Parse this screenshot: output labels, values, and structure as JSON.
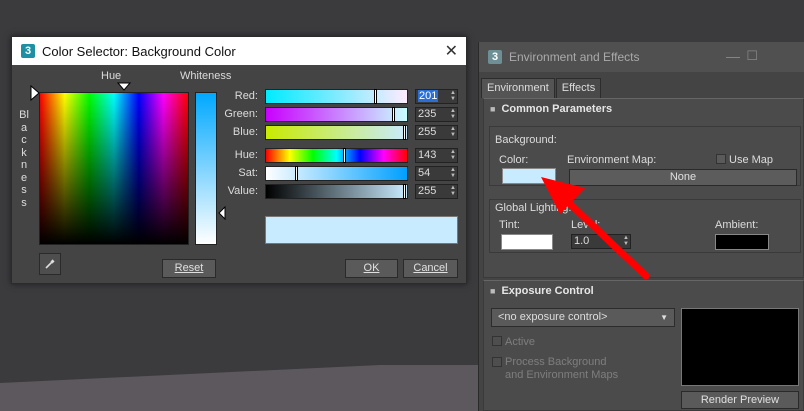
{
  "color_dialog": {
    "title": "Color Selector: Background Color",
    "hue_label": "Hue",
    "whiteness_label": "Whiteness",
    "blackness_label": "Blackness",
    "channels": [
      {
        "label": "Red:",
        "value": "201",
        "fraction": 0.79
      },
      {
        "label": "Green:",
        "value": "235",
        "fraction": 0.92
      },
      {
        "label": "Blue:",
        "value": "255",
        "fraction": 1.0
      },
      {
        "label": "Hue:",
        "value": "143",
        "fraction": 0.56
      },
      {
        "label": "Sat:",
        "value": "54",
        "fraction": 0.21
      },
      {
        "label": "Value:",
        "value": "255",
        "fraction": 1.0
      }
    ],
    "preview_color": "#c9ebff",
    "reset_label": "Reset",
    "ok_label": "OK",
    "cancel_label": "Cancel"
  },
  "env_window": {
    "title": "Environment and Effects",
    "tabs": [
      "Environment",
      "Effects"
    ],
    "common_params_title": "Common Parameters",
    "background_label": "Background:",
    "color_label": "Color:",
    "env_map_label": "Environment Map:",
    "use_map_label": "Use Map",
    "none_label": "None",
    "bg_color": "#c9ebff",
    "global_lighting_label": "Global Lighting:",
    "tint_label": "Tint:",
    "level_label": "Level:",
    "level_value": "1.0",
    "ambient_label": "Ambient:",
    "exposure_title": "Exposure Control",
    "exposure_dropdown": "<no exposure control>",
    "active_label": "Active",
    "process_bg_line1": "Process Background",
    "process_bg_line2": "and Environment Maps",
    "render_preview_label": "Render Preview"
  },
  "annotation": {
    "color": "#ff0000"
  }
}
